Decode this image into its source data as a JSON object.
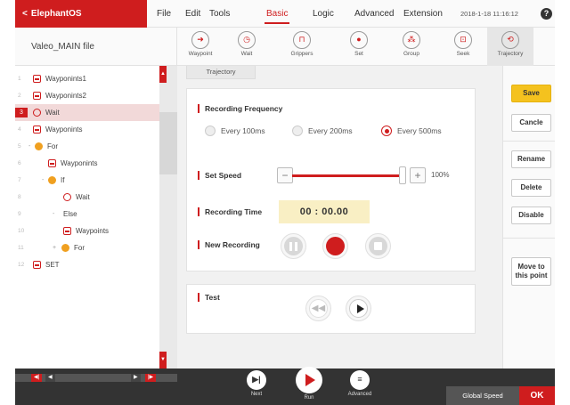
{
  "topbar": {
    "app_title": "ElephantOS",
    "menus": [
      "File",
      "Edit",
      "Tools",
      "Basic",
      "Logic",
      "Advanced",
      "Extension"
    ],
    "active_menu": "Basic",
    "datetime": "2018-1-18 11:16:12",
    "help": "?"
  },
  "file": {
    "name": "Valeo_MAIN file"
  },
  "toolbar": {
    "items": [
      {
        "label": "Waypoint",
        "icon": "waypoint-icon"
      },
      {
        "label": "Wait",
        "icon": "clock-icon"
      },
      {
        "label": "Grippers",
        "icon": "gripper-icon"
      },
      {
        "label": "Set",
        "icon": "set-icon"
      },
      {
        "label": "Group",
        "icon": "group-icon"
      },
      {
        "label": "Seek",
        "icon": "seek-icon"
      },
      {
        "label": "Trajectory",
        "icon": "trajectory-icon"
      }
    ],
    "active": "Trajectory"
  },
  "tree": {
    "rows": [
      {
        "num": "1",
        "label": "Wayponints1",
        "icon": "waypoint"
      },
      {
        "num": "2",
        "label": "Wayponints2",
        "icon": "waypoint"
      },
      {
        "num": "3",
        "label": "Wait",
        "icon": "wait",
        "selected": true
      },
      {
        "num": "4",
        "label": "Wayponints",
        "icon": "waypoint"
      },
      {
        "num": "5",
        "label": "For",
        "icon": "for",
        "toggle": "-"
      },
      {
        "num": "6",
        "label": "Wayponints",
        "icon": "waypoint"
      },
      {
        "num": "7",
        "label": "If",
        "icon": "for",
        "toggle": "-"
      },
      {
        "num": "8",
        "label": "Wait",
        "icon": "wait"
      },
      {
        "num": "9",
        "label": "Else",
        "icon": "",
        "toggle": "-"
      },
      {
        "num": "10",
        "label": "Waypoints",
        "icon": "waypoint"
      },
      {
        "num": "11",
        "label": "For",
        "icon": "for",
        "toggle": "+"
      },
      {
        "num": "12",
        "label": "SET",
        "icon": "waypoint"
      }
    ]
  },
  "main": {
    "tab": "Trajectory",
    "recording_frequency": {
      "title": "Recording Frequency",
      "options": [
        "Every 100ms",
        "Every 200ms",
        "Every 500ms"
      ],
      "selected": "Every 500ms"
    },
    "set_speed": {
      "title": "Set Speed",
      "value": "100%",
      "level": 1.0,
      "minus": "−",
      "plus": "+"
    },
    "recording_time": {
      "title": "Recording Time",
      "value": "00 : 00.00"
    },
    "new_recording": {
      "title": "New Recording"
    },
    "test": {
      "title": "Test",
      "rewind_glyph": "◀◀"
    }
  },
  "actions": {
    "save": "Save",
    "cancel": "Cancle",
    "rename": "Rename",
    "delete": "Delete",
    "disable": "Disable",
    "move": "Move to this point"
  },
  "bottombar": {
    "next": "Next",
    "run": "Run",
    "advanced": "Advanced",
    "global_speed": "Global Speed",
    "ok": "OK"
  },
  "colors": {
    "accent": "#cf1d1e",
    "save": "#f4c21e",
    "recording_time_bg": "#f9efc4",
    "for_icon": "#f0a020"
  }
}
